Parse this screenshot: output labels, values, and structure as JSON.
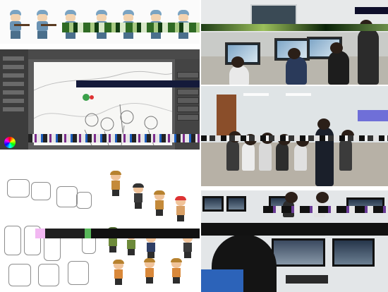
{
  "image": {
    "panels": [
      {
        "id": "sprites",
        "icon": "sprite-sheet-icon"
      },
      {
        "id": "office",
        "icon": "office-photo-icon"
      },
      {
        "id": "software",
        "icon": "drawing-app-icon"
      },
      {
        "id": "classroom",
        "icon": "classroom-photo-icon"
      },
      {
        "id": "characters",
        "icon": "character-sheet-icon"
      },
      {
        "id": "lab",
        "icon": "computer-lab-icon"
      }
    ],
    "colors": {
      "soldier_uniform": "#6b93b3",
      "grass_dark": "#2f6a24",
      "glitch_navy": "#141a3a",
      "software_gray": "#5b5b5b",
      "cabinet_brown": "#8a4e2a",
      "shirt_blue": "#2c63b9"
    }
  }
}
